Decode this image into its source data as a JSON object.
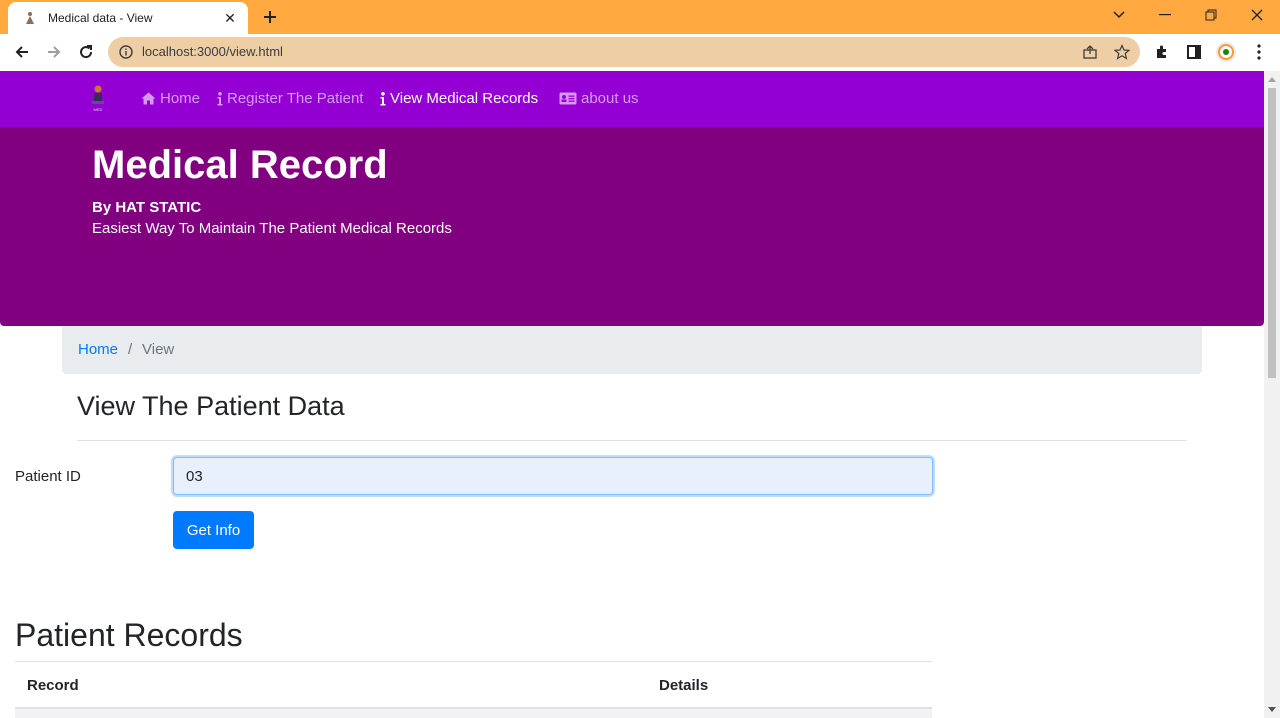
{
  "browser": {
    "tab_title": "Medical data - View",
    "url": "localhost:3000/view.html"
  },
  "navbar": {
    "items": [
      {
        "label": "Home",
        "icon": "home-icon"
      },
      {
        "label": "Register The Patient",
        "icon": "info-icon"
      },
      {
        "label": "View Medical Records",
        "icon": "info-icon",
        "active": true
      },
      {
        "label": "about us",
        "icon": "id-card-icon"
      }
    ]
  },
  "hero": {
    "title": "Medical Record",
    "byline": "By HAT STATIC",
    "tagline": "Easiest Way To Maintain The Patient Medical Records"
  },
  "breadcrumb": {
    "home": "Home",
    "separator": "/",
    "current": "View"
  },
  "form": {
    "heading": "View The Patient Data",
    "patient_id_label": "Patient ID",
    "patient_id_value": "03",
    "submit_label": "Get Info"
  },
  "records": {
    "heading": "Patient Records",
    "columns": [
      "Record",
      "Details"
    ]
  },
  "colors": {
    "tabstrip": "#ffa940",
    "navbar": "#9400d3",
    "hero": "#800080",
    "primary": "#007bff"
  }
}
